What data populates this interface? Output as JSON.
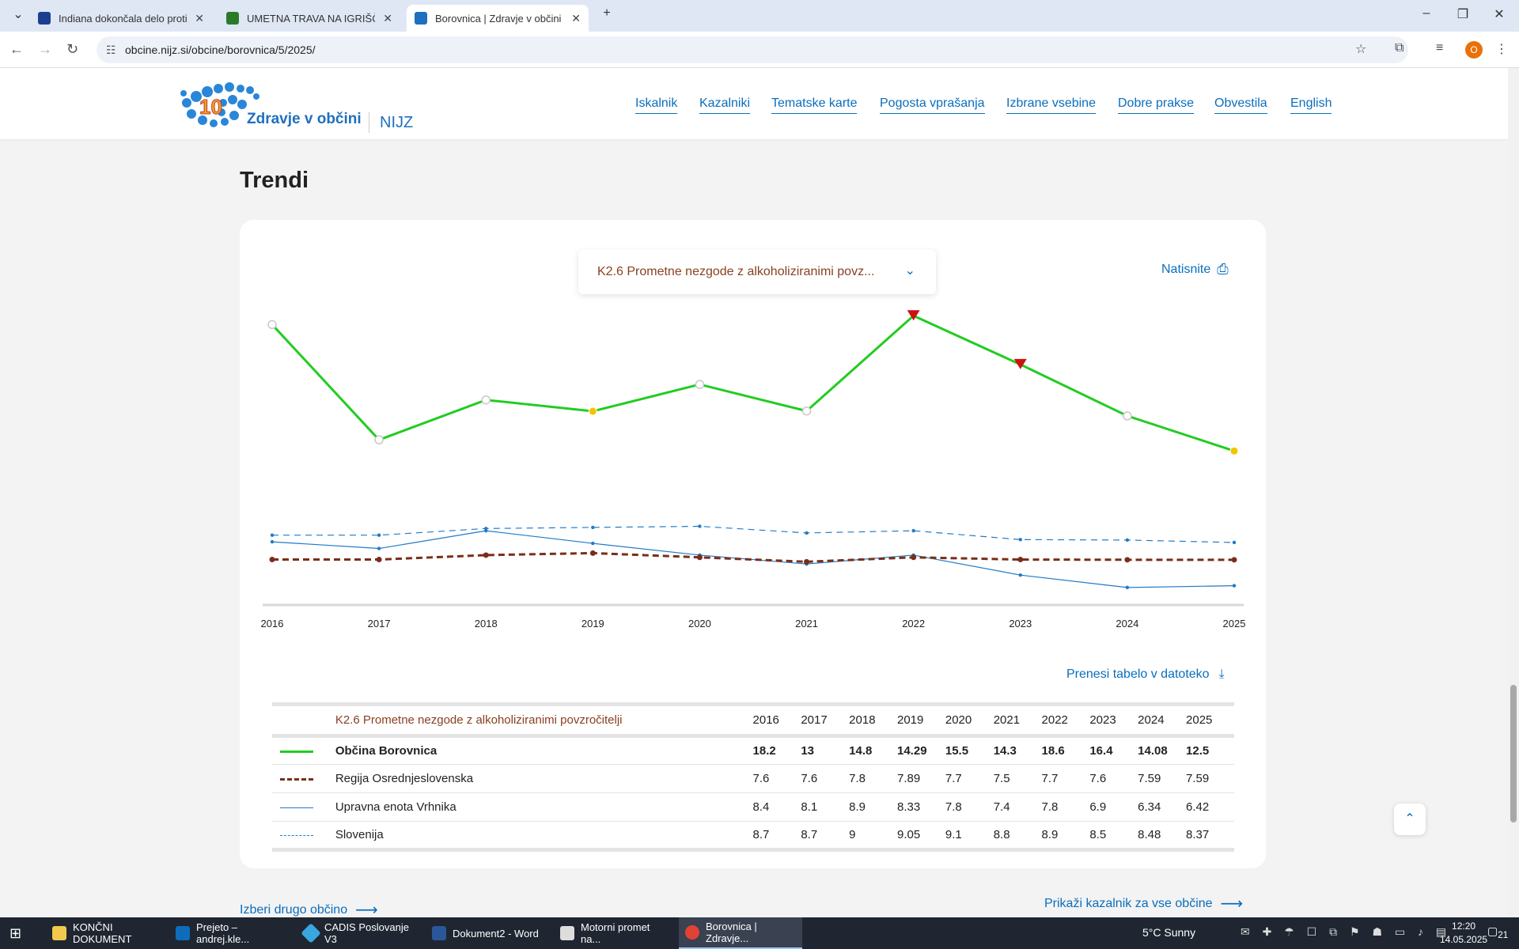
{
  "browser": {
    "tabs": [
      {
        "title": "Indiana dokončala delo proti pr...",
        "favicon_color": "#1b3f8f"
      },
      {
        "title": "UMETNA TRAVA NA IGRIŠČU V...",
        "favicon_color": "#2a7a2a"
      },
      {
        "title": "Borovnica | Zdravje v občini | N...",
        "favicon_color": "#1f6fbf"
      }
    ],
    "url": "obcine.nijz.si/obcine/borovnica/5/2025/",
    "profile_initial": "O"
  },
  "site": {
    "logo_number": "10",
    "logo_text": "Zdravje v občini",
    "logo_org": "NIJZ",
    "nav": [
      "Iskalnik",
      "Kazalniki",
      "Tematske karte",
      "Pogosta vprašanja",
      "Izbrane vsebine",
      "Dobre prakse",
      "Obvestila",
      "English"
    ]
  },
  "section": {
    "title": "Trendi",
    "indicator_select": "K2.6 Prometne nezgode z alkoholiziranimi povz...",
    "print_label": "Natisnite",
    "download_label": "Prenesi tabelo v datoteko",
    "all_municipalities_label": "Prikaži kazalnik za vse občine",
    "other_municipality_label": "Izberi drugo občino"
  },
  "chart_data": {
    "type": "line",
    "x": [
      "2016",
      "2017",
      "2018",
      "2019",
      "2020",
      "2021",
      "2022",
      "2023",
      "2024",
      "2025"
    ],
    "series": [
      {
        "name": "Občina Borovnica",
        "values": [
          18.2,
          13,
          14.8,
          14.29,
          15.5,
          14.3,
          18.6,
          16.4,
          14.08,
          12.5
        ],
        "color": "#22cc22",
        "style": "solid-thick",
        "markers": [
          "white",
          "white",
          "white",
          "yellow",
          "white",
          "white",
          "red-triangle",
          "red-triangle",
          "white",
          "yellow"
        ]
      },
      {
        "name": "Regija Osrednjeslovenska",
        "values": [
          7.6,
          7.6,
          7.8,
          7.89,
          7.7,
          7.5,
          7.7,
          7.6,
          7.59,
          7.59
        ],
        "color": "#7a2e1a",
        "style": "dashed-thick"
      },
      {
        "name": "Upravna enota Vrhnika",
        "values": [
          8.4,
          8.1,
          8.9,
          8.33,
          7.8,
          7.4,
          7.8,
          6.9,
          6.34,
          6.42
        ],
        "color": "#1f7ac8",
        "style": "solid-thin"
      },
      {
        "name": "Slovenija",
        "values": [
          8.7,
          8.7,
          9,
          9.05,
          9.1,
          8.8,
          8.9,
          8.5,
          8.48,
          8.37
        ],
        "color": "#1f7ac8",
        "style": "dashed-thin"
      }
    ]
  },
  "table": {
    "indicator": "K2.6 Prometne nezgode z alkoholiziranimi povzročitelji",
    "years": [
      "2016",
      "2017",
      "2018",
      "2019",
      "2020",
      "2021",
      "2022",
      "2023",
      "2024",
      "2025"
    ],
    "rows": [
      {
        "name": "Občina Borovnica",
        "values": [
          "18.2",
          "13",
          "14.8",
          "14.29",
          "15.5",
          "14.3",
          "18.6",
          "16.4",
          "14.08",
          "12.5"
        ]
      },
      {
        "name": "Regija Osrednjeslovenska",
        "values": [
          "7.6",
          "7.6",
          "7.8",
          "7.89",
          "7.7",
          "7.5",
          "7.7",
          "7.6",
          "7.59",
          "7.59"
        ]
      },
      {
        "name": "Upravna enota Vrhnika",
        "values": [
          "8.4",
          "8.1",
          "8.9",
          "8.33",
          "7.8",
          "7.4",
          "7.8",
          "6.9",
          "6.34",
          "6.42"
        ]
      },
      {
        "name": "Slovenija",
        "values": [
          "8.7",
          "8.7",
          "9",
          "9.05",
          "9.1",
          "8.8",
          "8.9",
          "8.5",
          "8.48",
          "8.37"
        ]
      }
    ]
  },
  "taskbar": {
    "items": [
      "KONČNI DOKUMENT",
      "Prejeto – andrej.kle...",
      "CADIS Poslovanje V3",
      "Dokument2 - Word",
      "Motorni promet na...",
      "Borovnica | Zdravje..."
    ],
    "weather": "5°C  Sunny",
    "time": "12:20",
    "date": "14.05.2025",
    "notifications": "21"
  }
}
